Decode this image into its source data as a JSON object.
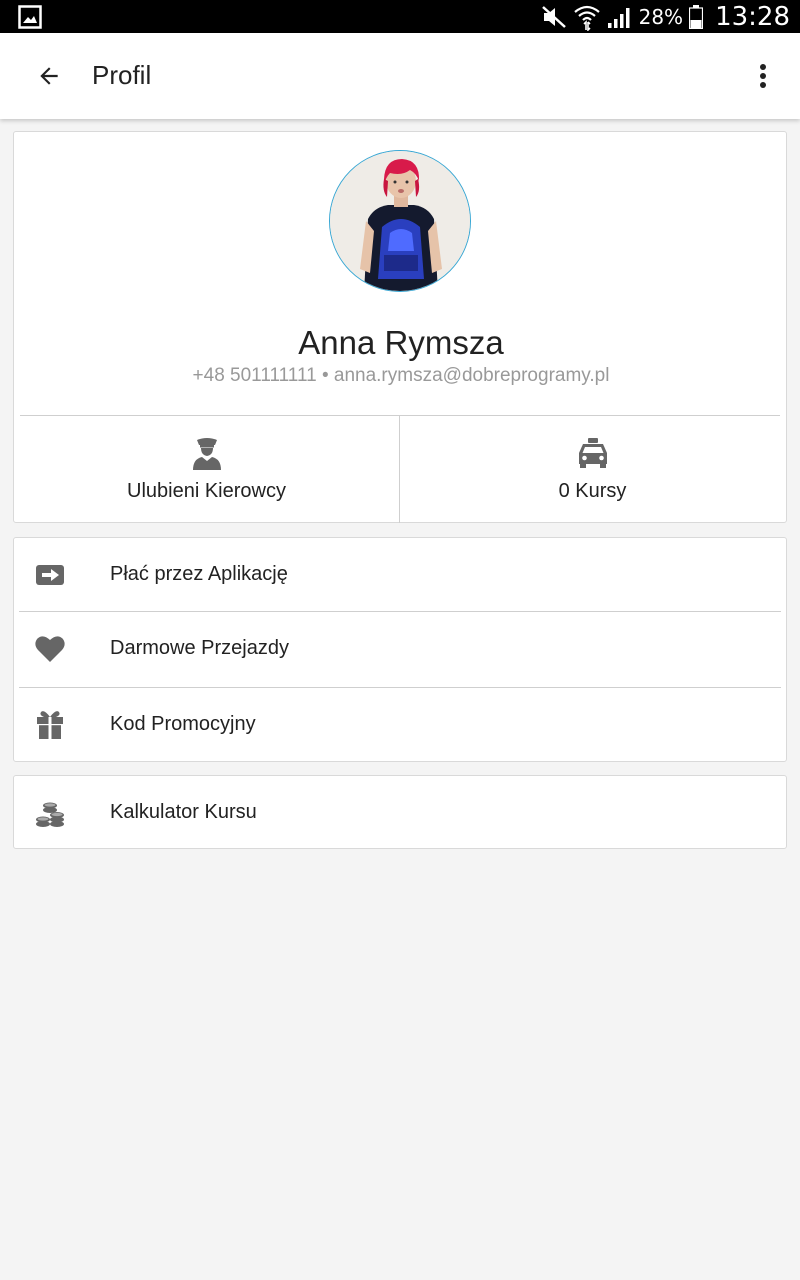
{
  "status_bar": {
    "battery_percent": "28%",
    "time": "13:28",
    "icons": [
      "gallery-icon",
      "mute-icon",
      "wifi-icon",
      "signal-icon",
      "battery-icon"
    ]
  },
  "app_bar": {
    "title": "Profil",
    "back_icon": "arrow-back-icon",
    "menu_icon": "more-vert-icon"
  },
  "profile": {
    "name": "Anna Rymsza",
    "contact": "+48 501111111 • anna.rymsza@dobreprogramy.pl",
    "avatar_border_color": "#38a7d4"
  },
  "stats": [
    {
      "label": "Ulubieni Kierowcy",
      "icon": "driver-icon"
    },
    {
      "label": "0 Kursy",
      "icon": "taxi-icon"
    }
  ],
  "menu": [
    {
      "label": "Płać przez Aplikację",
      "icon": "payment-arrow-icon"
    },
    {
      "label": "Darmowe Przejazdy",
      "icon": "heart-icon"
    },
    {
      "label": "Kod Promocyjny",
      "icon": "gift-icon"
    }
  ],
  "menu2": [
    {
      "label": "Kalkulator Kursu",
      "icon": "coins-icon"
    }
  ],
  "colors": {
    "icon_gray": "#666666",
    "background": "#f4f4f4",
    "accent": "#38a7d4"
  }
}
